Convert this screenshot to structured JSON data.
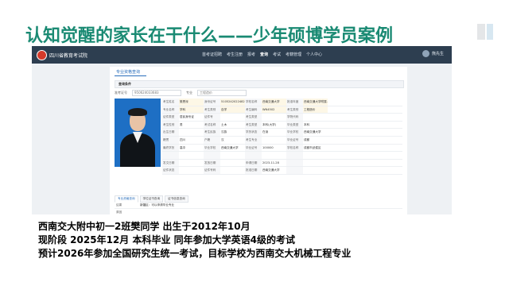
{
  "title": "认知觉醒的家长在干什么——少年硕博学员案例",
  "site": {
    "logo_text": "四川省教育考试院",
    "nav": [
      "首考证招聘",
      "考生注册",
      "报考",
      "查询",
      "考试",
      "考籍管理",
      "个人中心"
    ],
    "active_nav": "查询",
    "user": "熊先生",
    "page_tab": "专业资格查询",
    "section_title": "查询条件",
    "filters": [
      {
        "label": "准考证号",
        "value": "950624033683"
      },
      {
        "label": "专业",
        "value": "工程造价"
      }
    ],
    "grid": [
      [
        "考生姓名",
        "樊恩深",
        "身份证号",
        "5105242022482",
        "学校名称",
        "西南交通大学",
        "批准年度",
        "西南交通大学附属..."
      ],
      [
        "专业名称",
        "学科",
        "考生类别",
        "自学",
        "考生编码",
        "WN4502",
        "考生类别",
        "工程造价"
      ],
      [
        "证件类型",
        "居民身份证",
        "证件号",
        "",
        "考生类型",
        "",
        "学院代码",
        ""
      ],
      [
        "考生性别",
        "男",
        "考试名称",
        "土木",
        "考生类型",
        "本科(大学)",
        "毕业类型",
        "本科"
      ],
      [
        "出生日期",
        "",
        "考生民族",
        "汉族",
        "学历状态",
        "在读",
        "毕业学校",
        "西南交通大学"
      ],
      [
        "籍贯",
        "四川",
        "户籍",
        "汉",
        "考生专业",
        "",
        "毕业证号",
        "成都"
      ],
      [
        "最终学历",
        "高中",
        "毕业学校",
        "西南交通大学",
        "毕业证号",
        "100000",
        "学校名称",
        "成都市武侯区"
      ],
      [
        "",
        "",
        "",
        "",
        "",
        "",
        "",
        ""
      ],
      [
        "发文日期",
        "",
        "发放日期",
        "",
        "申请日期",
        "2023-11-28",
        "",
        ""
      ],
      [
        "证件状态",
        "",
        "证件号码",
        "",
        "批准日期",
        "西南交通大学",
        "",
        ""
      ]
    ],
    "subtabs": [
      "专业资格查询",
      "学位证书查询",
      "证书信息查询"
    ],
    "notes": [
      {
        "k": "结果",
        "v": "新疆区：可以申请毕业专业"
      },
      {
        "k": "原因",
        "v": ""
      }
    ]
  },
  "captions": [
    "西南交大附中初一2班樊同学  出生于2012年10月",
    "现阶段 2025年12月  本科毕业  同年参加大学英语4级的考试",
    "预计2026年参加全国研究生统一考试，目标学校为西南交大机械工程专业"
  ]
}
